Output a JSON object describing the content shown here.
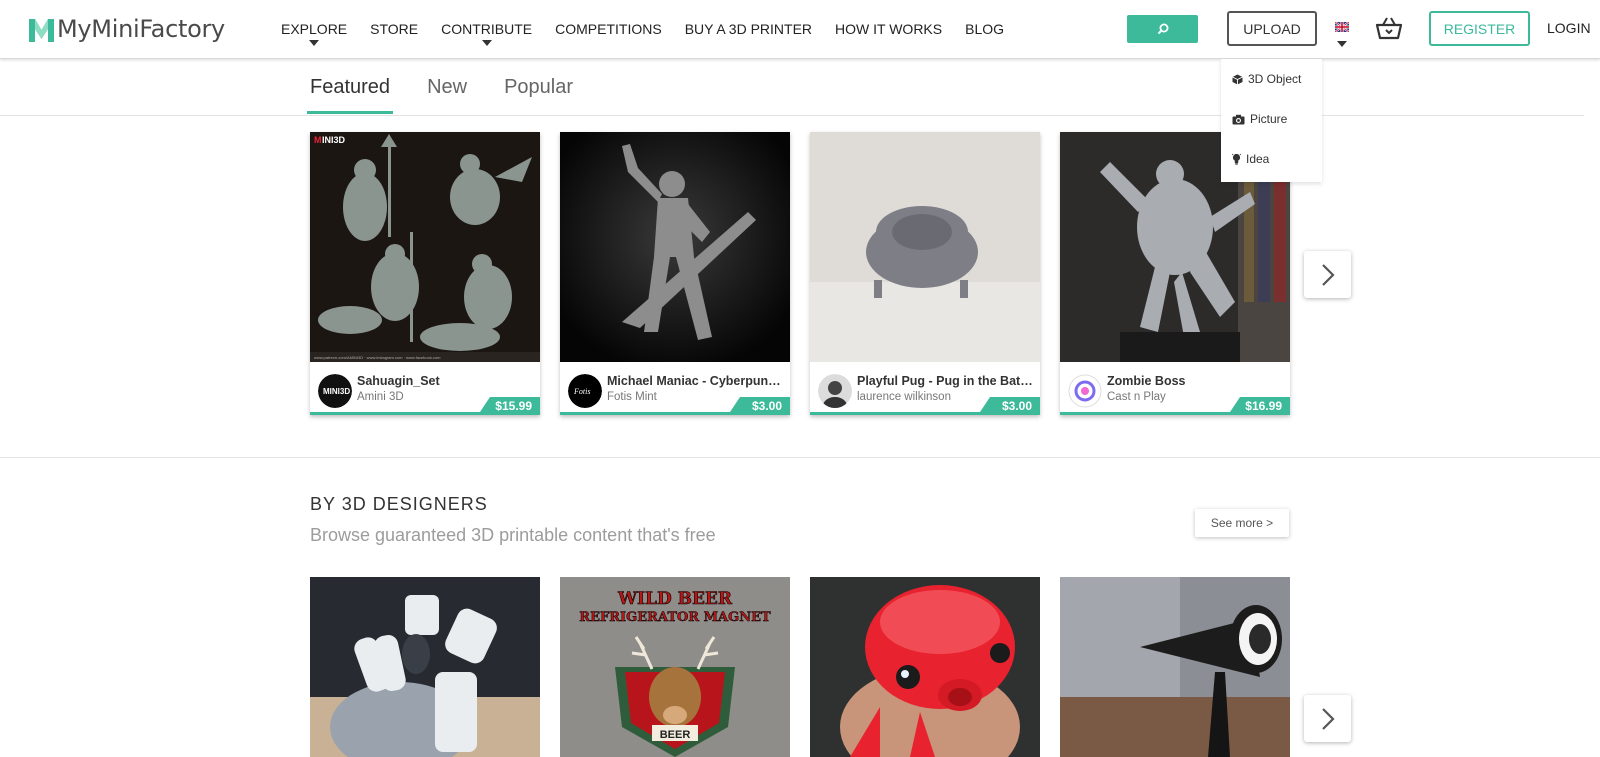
{
  "header": {
    "logo": "MyMiniFactory",
    "nav": [
      {
        "label": "EXPLORE",
        "dropdown": true
      },
      {
        "label": "STORE",
        "dropdown": false
      },
      {
        "label": "CONTRIBUTE",
        "dropdown": true
      },
      {
        "label": "COMPETITIONS",
        "dropdown": false
      },
      {
        "label": "BUY A 3D PRINTER",
        "dropdown": false
      },
      {
        "label": "HOW IT WORKS",
        "dropdown": false
      },
      {
        "label": "BLOG",
        "dropdown": false
      }
    ],
    "upload_label": "UPLOAD",
    "register_label": "REGISTER",
    "login_label": "LOGIN"
  },
  "upload_menu": [
    {
      "label": "3D Object",
      "icon": "cube-icon"
    },
    {
      "label": "Picture",
      "icon": "camera-icon"
    },
    {
      "label": "Idea",
      "icon": "lightbulb-icon"
    }
  ],
  "tabs": [
    {
      "label": "Featured",
      "active": true
    },
    {
      "label": "New",
      "active": false
    },
    {
      "label": "Popular",
      "active": false
    }
  ],
  "featured_cards": [
    {
      "title": "Sahuagin_Set",
      "author": "Amini 3D",
      "price": "$15.99"
    },
    {
      "title": "Michael Maniac - Cyberpunk Guitarist",
      "author": "Fotis Mint",
      "price": "$3.00"
    },
    {
      "title": "Playful Pug - Pug in the Bath Tub",
      "author": "laurence wilkinson",
      "price": "$3.00"
    },
    {
      "title": "Zombie Boss",
      "author": "Cast n Play",
      "price": "$16.99"
    }
  ],
  "designers_section": {
    "title": "BY 3D DESIGNERS",
    "subtitle": "Browse guaranteed 3D printable content that's free",
    "see_more": "See more >",
    "magnet_line1": "WILD BEER",
    "magnet_line2": "REFRIGERATOR MAGNET",
    "magnet_badge": "BEER"
  },
  "colors": {
    "accent": "#3dba99",
    "text": "#333333",
    "muted": "#9c9c9c"
  }
}
